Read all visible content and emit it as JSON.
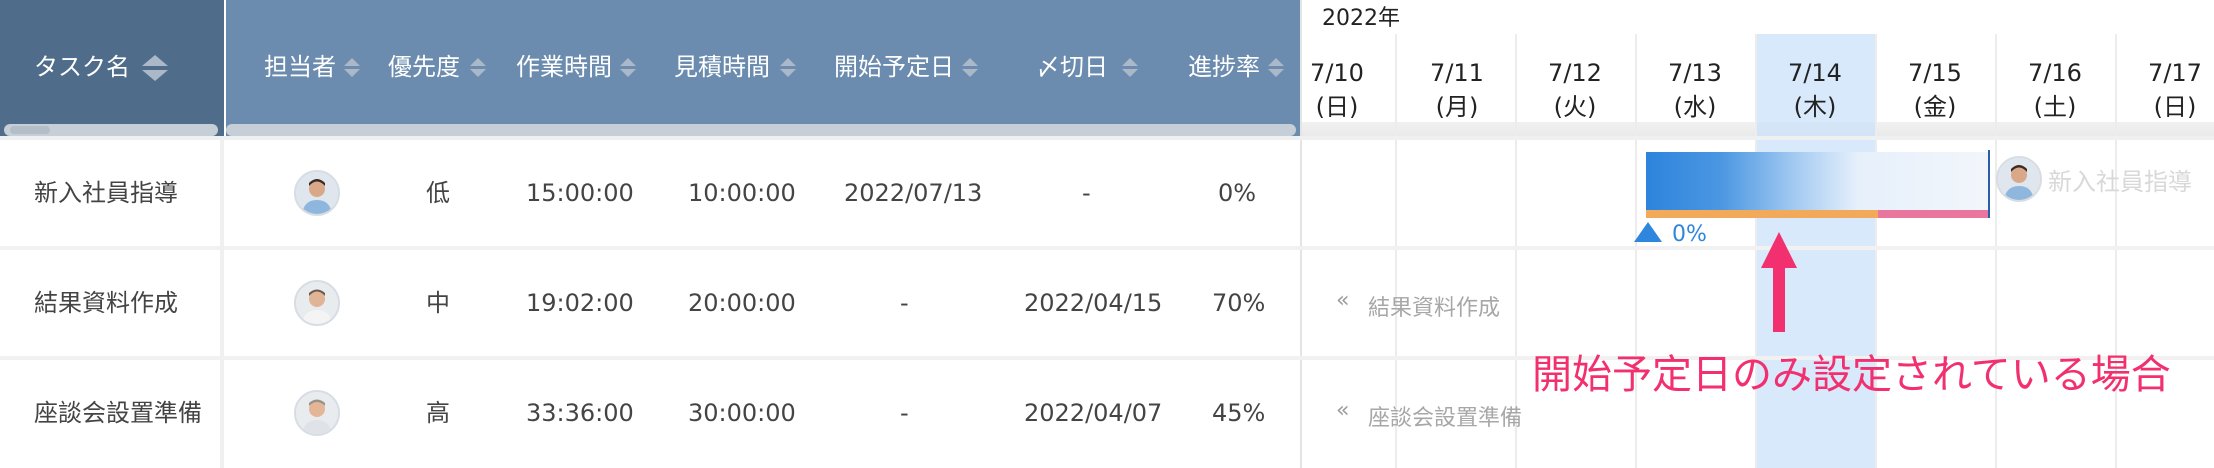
{
  "table": {
    "headers": {
      "task": "タスク名",
      "assignee": "担当者",
      "priority": "優先度",
      "work_time": "作業時間",
      "estimate": "見積時間",
      "start": "開始予定日",
      "due": "〆切日",
      "progress": "進捗率"
    },
    "rows": [
      {
        "name": "新入社員指導",
        "priority": "低",
        "work": "15:00:00",
        "estimate": "10:00:00",
        "start": "2022/07/13",
        "due": "-",
        "progress": "0%"
      },
      {
        "name": "結果資料作成",
        "priority": "中",
        "work": "19:02:00",
        "estimate": "20:00:00",
        "start": "-",
        "due": "2022/04/15",
        "progress": "70%"
      },
      {
        "name": "座談会設置準備",
        "priority": "高",
        "work": "33:36:00",
        "estimate": "30:00:00",
        "start": "-",
        "due": "2022/04/07",
        "progress": "45%"
      }
    ]
  },
  "gantt": {
    "year": "2022年",
    "days": [
      {
        "date": "7/10",
        "dow": "(日)"
      },
      {
        "date": "7/11",
        "dow": "(月)"
      },
      {
        "date": "7/12",
        "dow": "(火)"
      },
      {
        "date": "7/13",
        "dow": "(水)"
      },
      {
        "date": "7/14",
        "dow": "(木)"
      },
      {
        "date": "7/15",
        "dow": "(金)"
      },
      {
        "date": "7/16",
        "dow": "(土)"
      },
      {
        "date": "7/17",
        "dow": "(日)"
      }
    ],
    "bar": {
      "progress_label": "0%",
      "task_label": "新入社員指導"
    },
    "ghosts": [
      {
        "label": "結果資料作成"
      },
      {
        "label": "座談会設置準備"
      }
    ],
    "annotation": "開始予定日のみ設定されている場合"
  },
  "colors": {
    "header_dark": "#4f6d8b",
    "header": "#6b8cae",
    "today": "#c9e1fa",
    "bar_blue": "#2f86dd",
    "bar_orange": "#f3a95a",
    "bar_pink": "#e8769d",
    "annotation": "#f2306f"
  }
}
